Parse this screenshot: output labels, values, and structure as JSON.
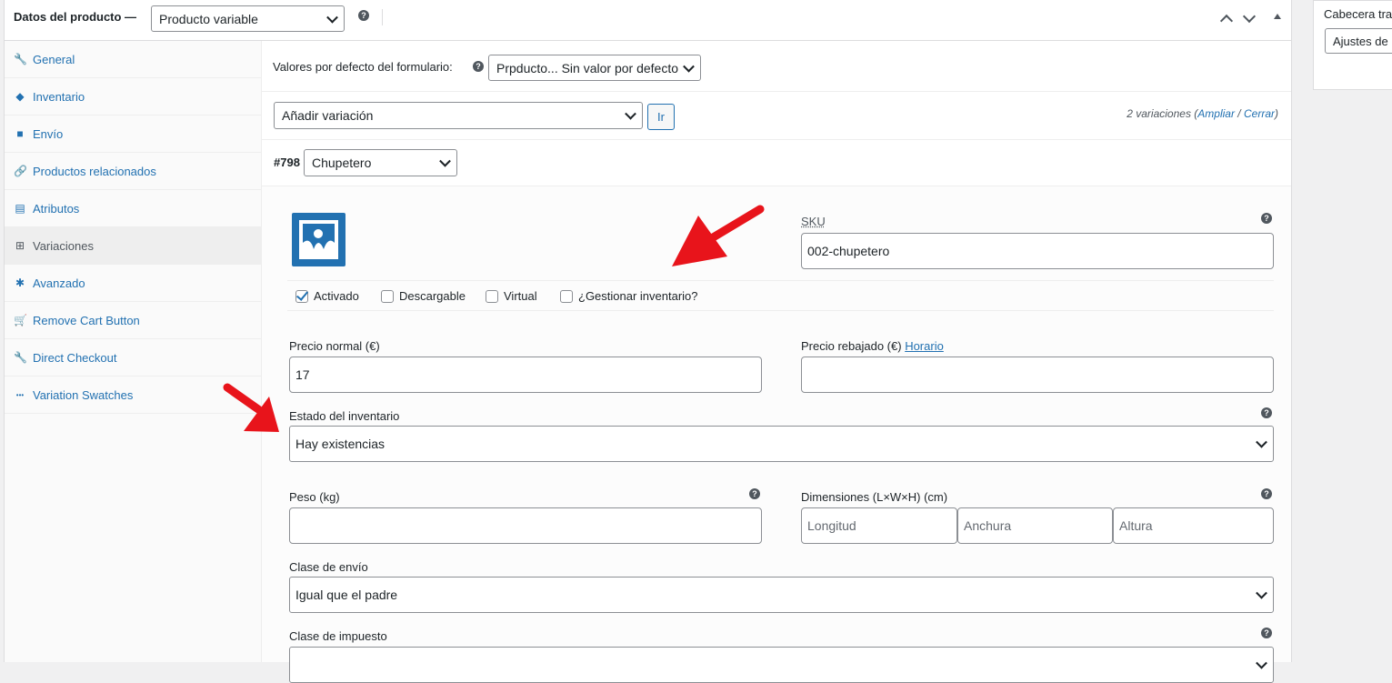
{
  "header": {
    "title": "Datos del producto —",
    "product_type": "Producto variable"
  },
  "side_panel": {
    "title": "Cabecera tra",
    "select_value": "Ajustes de"
  },
  "tabs": [
    {
      "label": "General",
      "icon": "wrench-icon",
      "glyph": "🔧"
    },
    {
      "label": "Inventario",
      "icon": "tag-icon",
      "glyph": "◆"
    },
    {
      "label": "Envío",
      "icon": "truck-icon",
      "glyph": "■"
    },
    {
      "label": "Productos relacionados",
      "icon": "link-icon",
      "glyph": "🔗"
    },
    {
      "label": "Atributos",
      "icon": "list-icon",
      "glyph": "▤"
    },
    {
      "label": "Variaciones",
      "icon": "grid-icon",
      "glyph": "⊞"
    },
    {
      "label": "Avanzado",
      "icon": "gear-icon",
      "glyph": "✱"
    },
    {
      "label": "Remove Cart Button",
      "icon": "cart-icon",
      "glyph": "🛒"
    },
    {
      "label": "Direct Checkout",
      "icon": "wrench-icon",
      "glyph": "🔧"
    },
    {
      "label": "Variation Swatches",
      "icon": "ellipsis-icon",
      "glyph": "•••"
    }
  ],
  "defaults": {
    "label": "Valores por defecto del formulario:",
    "value": "Prpducto... Sin valor por defecto"
  },
  "variation_actions": {
    "select_value": "Añadir variación",
    "go_label": "Ir",
    "count_text": "2 variaciones (",
    "expand_label": "Ampliar",
    "slash": " / ",
    "close_label": "Cerrar",
    "close_paren": ")"
  },
  "variation": {
    "id": "#798",
    "attribute_value": "Chupetero",
    "sku_label": "SKU",
    "sku_value": "002-chupetero",
    "checkboxes": [
      {
        "label": "Activado",
        "checked": true
      },
      {
        "label": "Descargable",
        "checked": false
      },
      {
        "label": "Virtual",
        "checked": false
      },
      {
        "label": "¿Gestionar inventario?",
        "checked": false
      }
    ],
    "regular_price_label": "Precio normal (€)",
    "regular_price_value": "17",
    "sale_price_label": "Precio rebajado (€)",
    "sale_schedule_link": "Horario",
    "sale_price_value": "",
    "stock_status_label": "Estado del inventario",
    "stock_status_value": "Hay existencias",
    "weight_label": "Peso (kg)",
    "weight_value": "",
    "dimensions_label": "Dimensiones (L×W×H) (cm)",
    "length_placeholder": "Longitud",
    "width_placeholder": "Anchura",
    "height_placeholder": "Altura",
    "shipping_class_label": "Clase de envío",
    "shipping_class_value": "Igual que el padre",
    "tax_class_label": "Clase de impuesto"
  },
  "colors": {
    "link": "#2271b1",
    "annotation_arrow": "#e8141b"
  }
}
